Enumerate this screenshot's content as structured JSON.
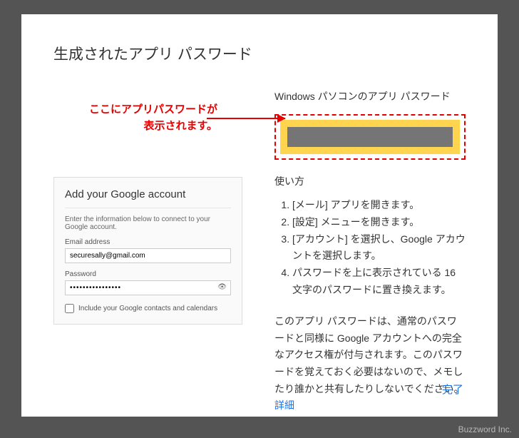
{
  "modal": {
    "title": "生成されたアプリ パスワード",
    "annotation_line1": "ここにアプリパスワードが",
    "annotation_line2": "表示されます。",
    "device_title": "Windows パソコンのアプリ パスワード",
    "howto_title": "使い方",
    "howto_steps": [
      "[メール] アプリを開きます。",
      "[設定] メニューを開きます。",
      "[アカウント] を選択し、Google アカウントを選択します。",
      "パスワードを上に表示されている 16 文字のパスワードに置き換えます。"
    ],
    "disclaimer": "このアプリ パスワードは、通常のパスワードと同様に Google アカウントへの完全なアクセス権が付与されます。このパスワードを覚えておく必要はないので、メモしたり誰かと共有したりしないでください。",
    "details_link": "詳細",
    "done_button": "完了"
  },
  "account_card": {
    "title": "Add your Google account",
    "description": "Enter the information below to connect to your Google account.",
    "email_label": "Email address",
    "email_value": "securesally@gmail.com",
    "password_label": "Password",
    "password_value": "••••••••••••••••",
    "checkbox_label": "Include your Google contacts and calendars"
  },
  "watermark": "Buzzword Inc."
}
